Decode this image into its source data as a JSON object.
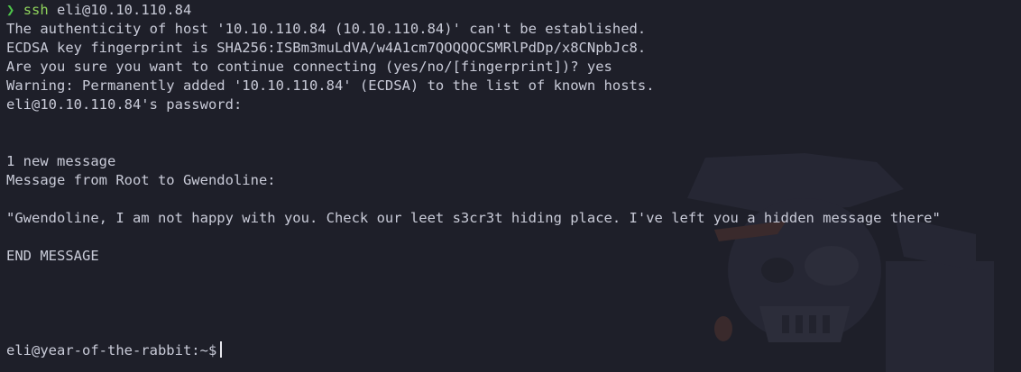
{
  "terminal": {
    "command": {
      "arrow": "❯",
      "program": "ssh",
      "args": " eli@10.10.110.84"
    },
    "output": [
      "The authenticity of host '10.10.110.84 (10.10.110.84)' can't be established.",
      "ECDSA key fingerprint is SHA256:ISBm3muLdVA/w4A1cm7QOQQOCSMRlPdDp/x8CNpbJc8.",
      "Are you sure you want to continue connecting (yes/no/[fingerprint])? yes",
      "Warning: Permanently added '10.10.110.84' (ECDSA) to the list of known hosts.",
      "eli@10.10.110.84's password:"
    ],
    "message": {
      "count": "1 new message",
      "from": "Message from Root to Gwendoline:",
      "body": "\"Gwendoline, I am not happy with you. Check our leet s3cr3t hiding place. I've left you a hidden message there\"",
      "end": "END MESSAGE"
    },
    "prompt": "eli@year-of-the-rabbit:~$"
  },
  "colors": {
    "background": "#1e1f29",
    "text": "#c9cbd8",
    "arrow": "#4ec44a",
    "command": "#8fd35c"
  }
}
